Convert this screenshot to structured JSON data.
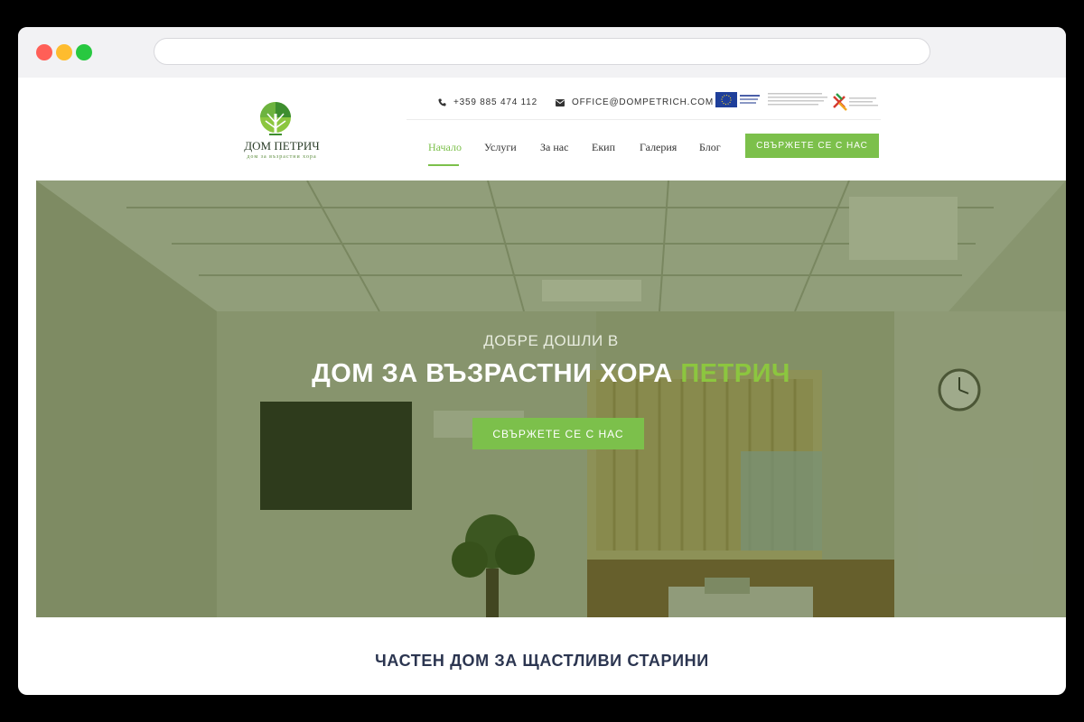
{
  "header": {
    "logo_title": "ДОМ ПЕТРИЧ",
    "logo_subtitle": "дом за възрастни хора",
    "phone": "+359 885 474 112",
    "email": "OFFICE@DOMPETRICH.COM",
    "icons": {
      "phone": "phone-icon",
      "email": "envelope-icon"
    }
  },
  "nav": {
    "items": [
      {
        "label": "Начало",
        "active": true
      },
      {
        "label": "Услуги"
      },
      {
        "label": "За нас"
      },
      {
        "label": "Екип"
      },
      {
        "label": "Галерия"
      },
      {
        "label": "Блог"
      }
    ],
    "cta": "СВЪРЖЕТЕ СЕ С НАС"
  },
  "hero": {
    "kicker": "ДОБРЕ ДОШЛИ В",
    "title_main": "ДОМ ЗА ВЪЗРАСТНИ ХОРА",
    "title_accent": "ПЕТРИЧ",
    "cta": "СВЪРЖЕТЕ СЕ С НАС"
  },
  "section": {
    "title": "ЧАСТЕН ДОМ ЗА ЩАСТЛИВИ СТАРИНИ"
  },
  "colors": {
    "accent": "#7cc04b",
    "title_accent": "#8cc63f",
    "heading": "#2b3550"
  }
}
